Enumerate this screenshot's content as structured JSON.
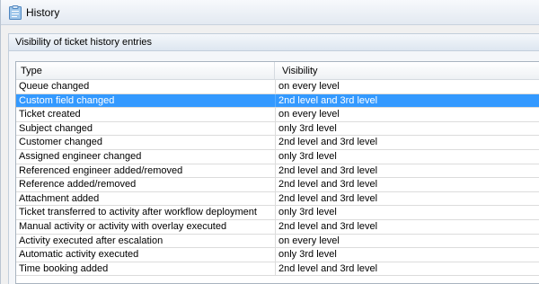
{
  "window": {
    "title": "History",
    "icon": "clipboard-icon"
  },
  "panel": {
    "title": "Visibility of ticket history entries"
  },
  "table": {
    "columns": [
      "Type",
      "Visibility"
    ],
    "selected_row": 1,
    "rows": [
      {
        "type": "Queue changed",
        "visibility": "on every level"
      },
      {
        "type": "Custom field changed",
        "visibility": "2nd level and 3rd level"
      },
      {
        "type": "Ticket created",
        "visibility": "on every level"
      },
      {
        "type": "Subject changed",
        "visibility": "only 3rd level"
      },
      {
        "type": "Customer changed",
        "visibility": "2nd level and 3rd level"
      },
      {
        "type": "Assigned engineer changed",
        "visibility": "only 3rd level"
      },
      {
        "type": "Referenced engineer added/removed",
        "visibility": "2nd level and 3rd level"
      },
      {
        "type": "Reference added/removed",
        "visibility": "2nd level and 3rd level"
      },
      {
        "type": "Attachment added",
        "visibility": "2nd level and 3rd level"
      },
      {
        "type": "Ticket transferred to activity after workflow deployment",
        "visibility": "only 3rd level"
      },
      {
        "type": "Manual activity or activity with overlay executed",
        "visibility": "2nd level and 3rd level"
      },
      {
        "type": "Activity executed after escalation",
        "visibility": "on every level"
      },
      {
        "type": "Automatic activity executed",
        "visibility": "only 3rd level"
      },
      {
        "type": "Time booking added",
        "visibility": "2nd level and 3rd level"
      }
    ]
  },
  "colors": {
    "selection": "#3399ff",
    "title_gradient_top": "#f7f9fc",
    "title_gradient_bottom": "#e3e9f1"
  }
}
